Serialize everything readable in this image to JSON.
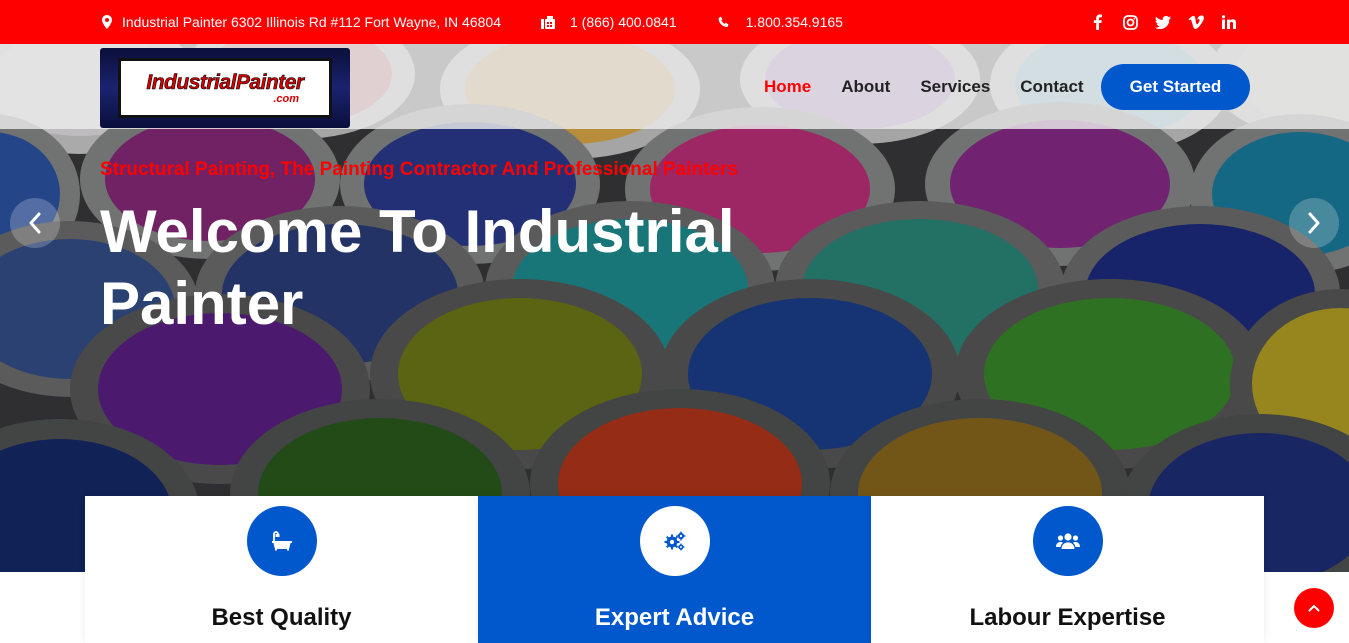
{
  "topbar": {
    "address": "Industrial Painter 6302 Illinois Rd #112 Fort Wayne, IN 46804",
    "fax": "1 (866) 400.0841",
    "phone": "1.800.354.9165",
    "social": [
      "facebook-icon",
      "instagram-icon",
      "twitter-icon",
      "vimeo-icon",
      "linkedin-icon"
    ]
  },
  "header": {
    "logo_main": "IndustrialPainter",
    "logo_sub": ".com",
    "nav": [
      {
        "label": "Home",
        "active": true
      },
      {
        "label": "About",
        "active": false
      },
      {
        "label": "Services",
        "active": false
      },
      {
        "label": "Contact",
        "active": false
      }
    ],
    "cta_label": "Get Started"
  },
  "hero": {
    "tagline": "Structural Painting, The Painting Contractor And Professional Painters",
    "headline": "Welcome To Industrial Painter"
  },
  "features": [
    {
      "title": "Best Quality",
      "icon": "bathtub-icon"
    },
    {
      "title": "Expert Advice",
      "icon": "cogs-icon"
    },
    {
      "title": "Labour Expertise",
      "icon": "users-icon"
    }
  ],
  "colors": {
    "brand_red": "#ff0000",
    "brand_blue": "#0058cc",
    "white": "#ffffff"
  }
}
